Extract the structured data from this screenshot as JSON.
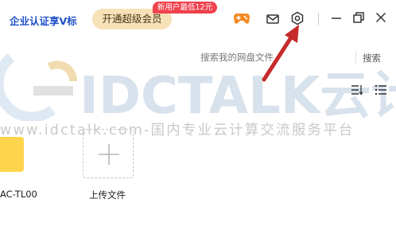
{
  "header": {
    "enterprise_label": "企业认证享V标",
    "vip_button_label": "开通超级会员",
    "promo_badge": "新用户最低12元",
    "icons": [
      "game-controller-icon",
      "mail-icon",
      "settings-icon",
      "minimize-icon",
      "restore-icon",
      "close-icon"
    ],
    "colors": {
      "accent_blue": "#1f50c8",
      "vip_gold": "#f7e2b8",
      "promo_red": "#f0424e",
      "annotation_arrow": "#c62a2a"
    }
  },
  "search": {
    "placeholder": "搜索我的网盘文件",
    "button_label": "搜索"
  },
  "view_controls": [
    "sort-icon",
    "list-view-icon"
  ],
  "files": [
    {
      "name": "AC-TL00",
      "type": "folder",
      "color": "#ffd44d"
    }
  ],
  "upload": {
    "label": "上传文件"
  },
  "watermark": {
    "big_text": "IDCTALK云计",
    "line_text": "www.idctalk.com-国内专业云计算交流服务平台"
  }
}
